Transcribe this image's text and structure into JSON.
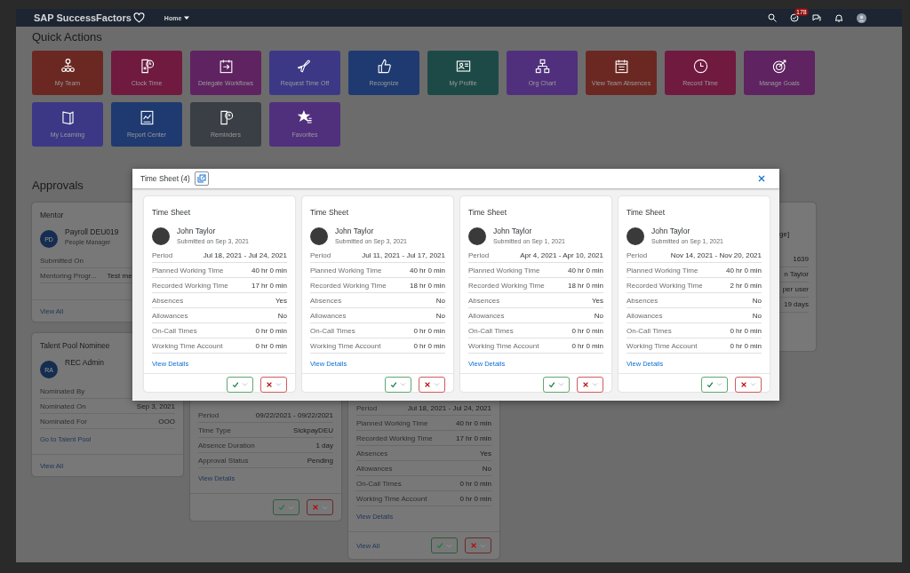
{
  "header": {
    "logo": "SAP SuccessFactors",
    "menu": "Home",
    "badge": "178"
  },
  "quick_actions": {
    "title": "Quick Actions",
    "tiles": [
      {
        "label": "My Team",
        "color": "#6b2822"
      },
      {
        "label": "Clock Time",
        "color": "#701a40"
      },
      {
        "label": "Delegate Workflows",
        "color": "#5e2360"
      },
      {
        "label": "Request Time Off",
        "color": "#3c3886"
      },
      {
        "label": "Recognize",
        "color": "#1f3a70"
      },
      {
        "label": "My Profile",
        "color": "#1d4a47"
      },
      {
        "label": "Org Chart",
        "color": "#50307d"
      },
      {
        "label": "View Team Absences",
        "color": "#6b2822"
      },
      {
        "label": "Record Time",
        "color": "#701a40"
      },
      {
        "label": "Manage Goals",
        "color": "#5e2360"
      },
      {
        "label": "My Learning",
        "color": "#3c3886"
      },
      {
        "label": "Report Center",
        "color": "#1f3a70"
      },
      {
        "label": "Reminders",
        "color": "#3a3f45"
      },
      {
        "label": "Favorites",
        "color": "#50307d"
      }
    ]
  },
  "approvals": {
    "title": "Approvals",
    "columns": [
      [
        {
          "kind": "mentor",
          "title": "Mentor",
          "initials": "PD",
          "name": "Payroll DEU019",
          "subtitle": "People Manager",
          "fields": [
            {
              "label": "Submitted On"
            },
            {
              "label": "Mentoring Progr...",
              "value": "Test me"
            }
          ],
          "footer_link": "View All",
          "actions": false
        },
        {
          "kind": "nominee",
          "title": "Talent Pool Nominee",
          "initials": "RA",
          "name": "REC Admin",
          "fields": [
            {
              "label": "Nominated By"
            },
            {
              "label": "Nominated On",
              "value": "Sep 3, 2021"
            },
            {
              "label": "Nominated For",
              "value": "OOO"
            }
          ],
          "link": "Go to Talent Pool",
          "footer_link": "View All",
          "actions": false
        }
      ],
      [
        {
          "kind": "lower",
          "fields": [
            {
              "label": "Period",
              "value": "09/22/2021 - 09/22/2021"
            },
            {
              "label": "Time Type",
              "value": "SickpayDEU"
            },
            {
              "label": "Absence Duration",
              "value": "1 day"
            },
            {
              "label": "Approval Status",
              "value": "Pending"
            }
          ],
          "link": "View Details",
          "actions": true
        }
      ],
      [
        {
          "kind": "lower",
          "fields": [
            {
              "label": "Period",
              "value": "Jul 18, 2021 - Jul 24, 2021"
            },
            {
              "label": "Planned Working Time",
              "value": "40 hr 0 min"
            },
            {
              "label": "Recorded Working Time",
              "value": "17 hr 0 min"
            },
            {
              "label": "Absences",
              "value": "Yes"
            },
            {
              "label": "Allowances",
              "value": "No"
            },
            {
              "label": "On-Call Times",
              "value": "0 hr 0 min"
            },
            {
              "label": "Working Time Account",
              "value": "0 hr 0 min"
            }
          ],
          "link": "View Details",
          "footer_link": "View All",
          "actions": true
        }
      ],
      [
        {
          "kind": "edge",
          "title_fragment": "ge]",
          "values": [
            "1639",
            "n Taylor",
            "per user",
            "19 days"
          ]
        }
      ]
    ]
  },
  "dialog": {
    "title": "Time Sheet (4)",
    "cards": [
      {
        "title": "Time Sheet",
        "name": "John Taylor",
        "submitted": "Submitted on Sep 3, 2021",
        "fields": [
          {
            "label": "Period",
            "value": "Jul 18, 2021 - Jul 24, 2021"
          },
          {
            "label": "Planned Working Time",
            "value": "40 hr 0 min"
          },
          {
            "label": "Recorded Working Time",
            "value": "17 hr 0 min"
          },
          {
            "label": "Absences",
            "value": "Yes"
          },
          {
            "label": "Allowances",
            "value": "No"
          },
          {
            "label": "On-Call Times",
            "value": "0 hr 0 min"
          },
          {
            "label": "Working Time Account",
            "value": "0 hr 0 min"
          }
        ],
        "link": "View Details"
      },
      {
        "title": "Time Sheet",
        "name": "John Taylor",
        "submitted": "Submitted on Sep 3, 2021",
        "fields": [
          {
            "label": "Period",
            "value": "Jul 11, 2021 - Jul 17, 2021"
          },
          {
            "label": "Planned Working Time",
            "value": "40 hr 0 min"
          },
          {
            "label": "Recorded Working Time",
            "value": "18 hr 0 min"
          },
          {
            "label": "Absences",
            "value": "No"
          },
          {
            "label": "Allowances",
            "value": "No"
          },
          {
            "label": "On-Call Times",
            "value": "0 hr 0 min"
          },
          {
            "label": "Working Time Account",
            "value": "0 hr 0 min"
          }
        ],
        "link": "View Details"
      },
      {
        "title": "Time Sheet",
        "name": "John Taylor",
        "submitted": "Submitted on Sep 1, 2021",
        "fields": [
          {
            "label": "Period",
            "value": "Apr 4, 2021 - Apr 10, 2021"
          },
          {
            "label": "Planned Working Time",
            "value": "40 hr 0 min"
          },
          {
            "label": "Recorded Working Time",
            "value": "18 hr 0 min"
          },
          {
            "label": "Absences",
            "value": "Yes"
          },
          {
            "label": "Allowances",
            "value": "No"
          },
          {
            "label": "On-Call Times",
            "value": "0 hr 0 min"
          },
          {
            "label": "Working Time Account",
            "value": "0 hr 0 min"
          }
        ],
        "link": "View Details"
      },
      {
        "title": "Time Sheet",
        "name": "John Taylor",
        "submitted": "Submitted on Sep 1, 2021",
        "fields": [
          {
            "label": "Period",
            "value": "Nov 14, 2021 - Nov 20, 2021"
          },
          {
            "label": "Planned Working Time",
            "value": "40 hr 0 min"
          },
          {
            "label": "Recorded Working Time",
            "value": "2 hr 0 min"
          },
          {
            "label": "Absences",
            "value": "No"
          },
          {
            "label": "Allowances",
            "value": "No"
          },
          {
            "label": "On-Call Times",
            "value": "0 hr 0 min"
          },
          {
            "label": "Working Time Account",
            "value": "0 hr 0 min"
          }
        ],
        "link": "View Details"
      }
    ]
  }
}
